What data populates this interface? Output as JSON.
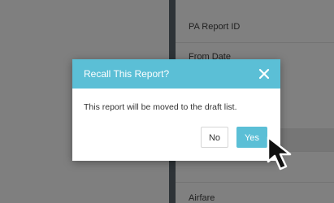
{
  "background_page": {
    "field_labels": [
      "PA Report ID",
      "From Date",
      "Airfare"
    ]
  },
  "dialog": {
    "title": "Recall This Report?",
    "message": "This report will be moved to the draft list.",
    "no_label": "No",
    "yes_label": "Yes",
    "close_icon": "close-icon"
  },
  "colors": {
    "accent": "#5bbfd6",
    "overlay": "#7f7f7f",
    "divider": "#2e3337"
  }
}
